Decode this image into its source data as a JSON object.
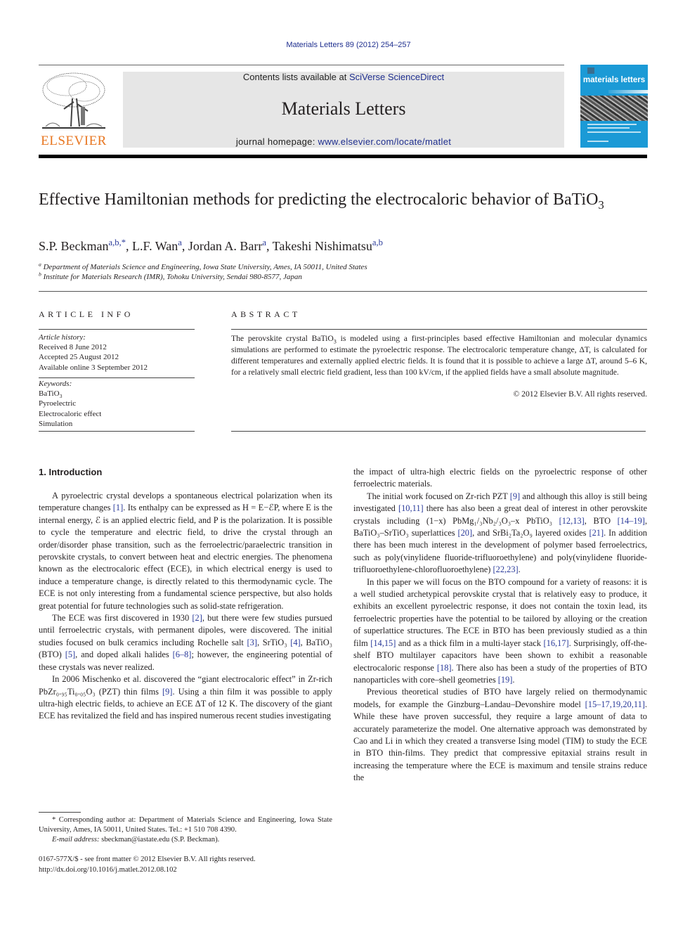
{
  "header": {
    "journal_reference": "Materials Letters 89 (2012) 254–257",
    "contents_prefix": "Contents lists available at ",
    "contents_link": "SciVerse ScienceDirect",
    "journal_title": "Materials Letters",
    "homepage_prefix": "journal homepage: ",
    "homepage_link": "www.elsevier.com/locate/matlet",
    "publisher_logo_text": "ELSEVIER",
    "cover_title": "materials letters",
    "brand_colors": {
      "elsevier_orange": "#e87722",
      "cover_blue": "#1b9ad6",
      "link_blue": "#1f2f8f"
    }
  },
  "article": {
    "title_main": "Effective Hamiltonian methods for predicting the electrocaloric behavior of BaTiO",
    "title_sub": "3",
    "authors": [
      {
        "name": "S.P. Beckman",
        "affiliations": "a,b,",
        "corresponding": "*"
      },
      {
        "name": "L.F. Wan",
        "affiliations": "a",
        "corresponding": ""
      },
      {
        "name": "Jordan A. Barr",
        "affiliations": "a",
        "corresponding": ""
      },
      {
        "name": "Takeshi Nishimatsu",
        "affiliations": "a,b",
        "corresponding": ""
      }
    ],
    "affiliations": [
      {
        "key": "a",
        "text": "Department of Materials Science and Engineering, Iowa State University, Ames, IA 50011, United States"
      },
      {
        "key": "b",
        "text": "Institute for Materials Research (IMR), Tohoku University, Sendai 980-8577, Japan"
      }
    ]
  },
  "article_info": {
    "heading": "ARTICLE INFO",
    "history_label": "Article history:",
    "received": "Received 8 June 2012",
    "accepted": "Accepted 25 August 2012",
    "online": "Available online 3 September 2012",
    "keywords_label": "Keywords:",
    "keywords": [
      "BaTiO3",
      "Pyroelectric",
      "Electrocaloric effect",
      "Simulation"
    ]
  },
  "abstract": {
    "heading": "ABSTRACT",
    "p1": "The perovskite crystal BaTiO",
    "p1_sub": "3",
    "p2": " is modeled using a first-principles based effective Hamiltonian and molecular dynamics simulations are performed to estimate the pyroelectric response. The electrocaloric temperature change, ΔT, is calculated for different temperatures and externally applied electric fields. It is found that it is possible to achieve a large ΔT, around 5–6 K, for a relatively small electric field gradient, less than 100 kV/cm, if the applied fields have a small absolute magnitude.",
    "copyright": "© 2012 Elsevier B.V. All rights reserved."
  },
  "intro": {
    "heading": "1.  Introduction",
    "left": [
      "A pyroelectric crystal develops a spontaneous electrical polarization when its temperature changes [1]. Its enthalpy can be expressed as H = E−ℰP, where E is the internal energy, ℰ is an applied electric field, and P is the polarization. It is possible to cycle the temperature and electric field, to drive the crystal through an order/disorder phase transition, such as the ferroelectric/paraelectric transition in perovskite crystals, to convert between heat and electric energies. The phenomena known as the electrocaloric effect (ECE), in which electrical energy is used to induce a temperature change, is directly related to this thermodynamic cycle. The ECE is not only interesting from a fundamental science perspective, but also holds great potential for future technologies such as solid-state refrigeration.",
      "The ECE was first discovered in 1930 [2], but there were few studies pursued until ferroelectric crystals, with permanent dipoles, were discovered. The initial studies focused on bulk ceramics including Rochelle salt [3], SrTiO₃ [4], BaTiO₃ (BTO) [5], and doped alkali halides [6–8]; however, the engineering potential of these crystals was never realized.",
      "In 2006 Mischenko et al. discovered the “giant electrocaloric effect” in Zr-rich PbZr₀.₉₅Ti₀.₀₅O₃ (PZT) thin films [9]. Using a thin film it was possible to apply ultra-high electric fields, to achieve an ECE ΔT of 12 K. The discovery of the giant ECE has revitalized the field and has inspired numerous recent studies investigating"
    ],
    "right": [
      "the impact of ultra-high electric fields on the pyroelectric response of other ferroelectric materials.",
      "The initial work focused on Zr-rich PZT [9] and although this alloy is still being investigated [10,11] there has also been a great deal of interest in other perovskite crystals including (1−x) PbMg₁/₃Nb₂/₃O₃–x PbTiO₃ [12,13], BTO [14–19], BaTiO₃–SrTiO₃ superlattices [20], and SrBi₂Ta₂O₉ layered oxides [21]. In addition there has been much interest in the development of polymer based ferroelectrics, such as poly(vinylidene fluoride-trifluoroethylene) and poly(vinylidene fluoride-trifluoroethylene-chlorofluoroethylene) [22,23].",
      "In this paper we will focus on the BTO compound for a variety of reasons: it is a well studied archetypical perovskite crystal that is relatively easy to produce, it exhibits an excellent pyroelectric response, it does not contain the toxin lead, its ferroelectric properties have the potential to be tailored by alloying or the creation of superlattice structures. The ECE in BTO has been previously studied as a thin film [14,15] and as a thick film in a multi-layer stack [16,17]. Surprisingly, off-the-shelf BTO multilayer capacitors have been shown to exhibit a reasonable electrocaloric response [18]. There also has been a study of the properties of BTO nanoparticles with core–shell geometries [19].",
      "Previous theoretical studies of BTO have largely relied on thermodynamic models, for example the Ginzburg–Landau–Devonshire model [15–17,19,20,11]. While these have proven successful, they require a large amount of data to accurately parameterize the model. One alternative approach was demonstrated by Cao and Li in which they created a transverse Ising model (TIM) to study the ECE in BTO thin-films. They predict that compressive epitaxial strains result in increasing the temperature where the ECE is maximum and tensile strains reduce the"
    ]
  },
  "footnote": {
    "corresponding": "* Corresponding author at: Department of Materials Science and Engineering, Iowa State University, Ames, IA 50011, United States. Tel.: +1 510 708 4390.",
    "email_label": "E-mail address:",
    "email": " sbeckman@iastate.edu (S.P. Beckman)."
  },
  "front_matter": {
    "issn_line": "0167-577X/$ - see front matter © 2012 Elsevier B.V. All rights reserved.",
    "doi": "http://dx.doi.org/10.1016/j.matlet.2012.08.102"
  }
}
